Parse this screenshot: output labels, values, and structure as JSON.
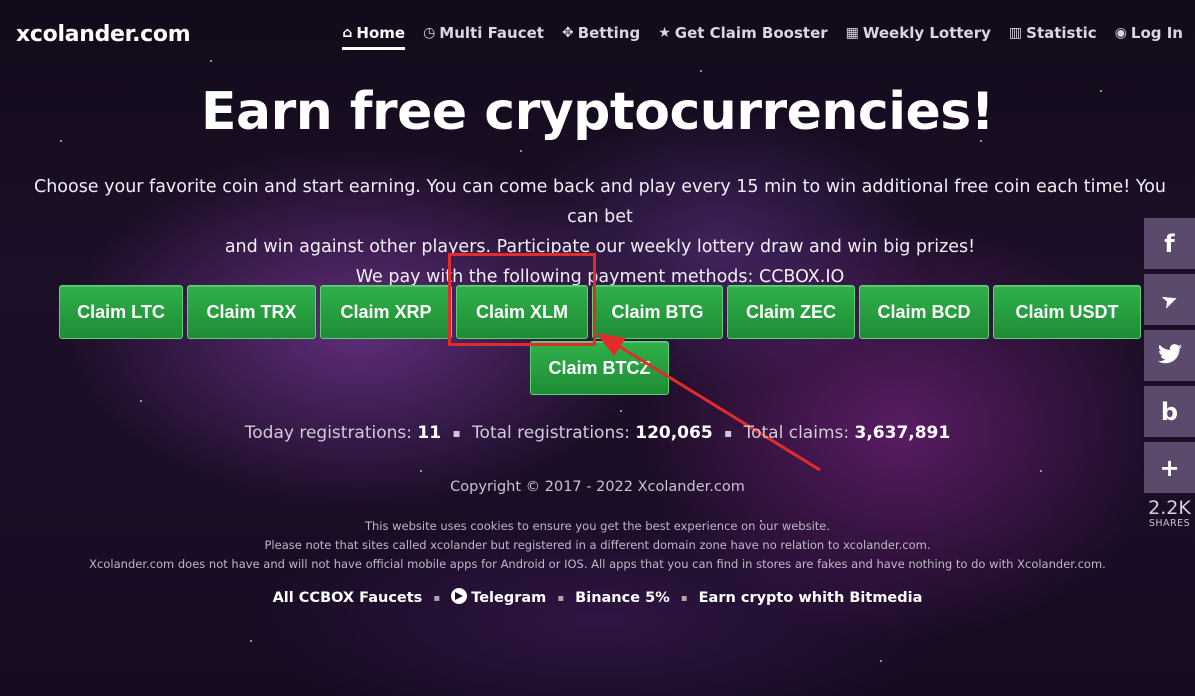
{
  "logo": "xcolander.com",
  "nav": [
    {
      "icon": "home-icon",
      "glyph": "⌂",
      "label": "Home"
    },
    {
      "icon": "clock-icon",
      "glyph": "◷",
      "label": "Multi Faucet"
    },
    {
      "icon": "crosshair-icon",
      "glyph": "✥",
      "label": "Betting"
    },
    {
      "icon": "star-icon",
      "glyph": "★",
      "label": "Get Claim Booster"
    },
    {
      "icon": "grid-icon",
      "glyph": "▦",
      "label": "Weekly Lottery"
    },
    {
      "icon": "bar-chart-icon",
      "glyph": "▥",
      "label": "Statistic"
    },
    {
      "icon": "user-icon",
      "glyph": "◉",
      "label": "Log In"
    }
  ],
  "hero": {
    "title": "Earn free cryptocurrencies!",
    "line1": "Choose your favorite coin and start earning. You can come back and play every 15 min to win additional free coin each time! You can bet",
    "line2": "and win against other players. Participate our weekly lottery draw and win big prizes!",
    "line3": "We pay with the following payment methods: CCBOX.IO"
  },
  "claims": [
    "Claim LTC",
    "Claim TRX",
    "Claim XRP",
    "Claim XLM",
    "Claim BTG",
    "Claim ZEC",
    "Claim BCD",
    "Claim USDT",
    "Claim BTCZ"
  ],
  "stats": {
    "today_label": "Today registrations:",
    "today_value": "11",
    "total_label": "Total registrations:",
    "total_value": "120,065",
    "claims_label": "Total claims:",
    "claims_value": "3,637,891"
  },
  "copyright": "Copyright © 2017 - 2022 Xcolander.com",
  "notes": [
    "This website uses cookies to ensure you get the best experience on our website.",
    "Please note that sites called xcolander but registered in a different domain zone have no relation to xcolander.com.",
    "Xcolander.com does not have and will not have official mobile apps for Android or IOS. All apps that you can find in stores are fakes and have nothing to do with Xcolander.com."
  ],
  "footer_links": [
    "All CCBOX Faucets",
    "Telegram",
    "Binance 5%",
    "Earn crypto whith Bitmedia"
  ],
  "share": {
    "buttons": [
      {
        "icon": "facebook-icon",
        "glyph": "f"
      },
      {
        "icon": "telegram-icon",
        "glyph": "➤"
      },
      {
        "icon": "twitter-icon",
        "glyph": "🐦"
      },
      {
        "icon": "bitmedia-icon",
        "glyph": "b"
      },
      {
        "icon": "plus-icon",
        "glyph": "+"
      }
    ],
    "count": "2.2K",
    "label": "SHARES"
  },
  "colors": {
    "button_green": "#28a745",
    "highlight_red": "#e22b2b",
    "share_bg": "#5b4a6b"
  }
}
